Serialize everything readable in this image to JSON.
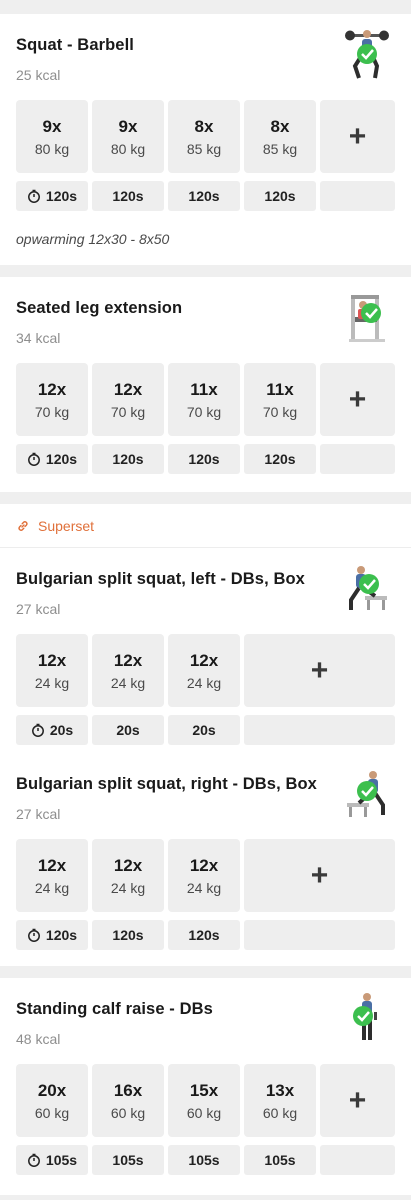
{
  "timer_icon": "stopwatch-icon",
  "add_label": "+",
  "superset_label": "Superset",
  "accent": "#e0703a",
  "check_color": "#3cbf4e",
  "exercises": [
    {
      "title": "Squat - Barbell",
      "kcal": "25 kcal",
      "sets": [
        {
          "reps": "9x",
          "weight": "80 kg"
        },
        {
          "reps": "9x",
          "weight": "80 kg"
        },
        {
          "reps": "8x",
          "weight": "85 kg"
        },
        {
          "reps": "8x",
          "weight": "85 kg"
        }
      ],
      "rests": [
        "120s",
        "120s",
        "120s",
        "120s"
      ],
      "note": "opwarming 12x30 - 8x50"
    },
    {
      "title": "Seated leg extension",
      "kcal": "34 kcal",
      "sets": [
        {
          "reps": "12x",
          "weight": "70 kg"
        },
        {
          "reps": "12x",
          "weight": "70 kg"
        },
        {
          "reps": "11x",
          "weight": "70 kg"
        },
        {
          "reps": "11x",
          "weight": "70 kg"
        }
      ],
      "rests": [
        "120s",
        "120s",
        "120s",
        "120s"
      ]
    },
    {
      "title": "Bulgarian split squat, left - DBs, Box",
      "kcal": "27 kcal",
      "sets": [
        {
          "reps": "12x",
          "weight": "24 kg"
        },
        {
          "reps": "12x",
          "weight": "24 kg"
        },
        {
          "reps": "12x",
          "weight": "24 kg"
        }
      ],
      "rests": [
        "20s",
        "20s",
        "20s"
      ]
    },
    {
      "title": "Bulgarian split squat, right - DBs, Box",
      "kcal": "27 kcal",
      "sets": [
        {
          "reps": "12x",
          "weight": "24 kg"
        },
        {
          "reps": "12x",
          "weight": "24 kg"
        },
        {
          "reps": "12x",
          "weight": "24 kg"
        }
      ],
      "rests": [
        "120s",
        "120s",
        "120s"
      ]
    },
    {
      "title": "Standing calf raise - DBs",
      "kcal": "48 kcal",
      "sets": [
        {
          "reps": "20x",
          "weight": "60 kg"
        },
        {
          "reps": "16x",
          "weight": "60 kg"
        },
        {
          "reps": "15x",
          "weight": "60 kg"
        },
        {
          "reps": "13x",
          "weight": "60 kg"
        }
      ],
      "rests": [
        "105s",
        "105s",
        "105s",
        "105s"
      ]
    }
  ]
}
